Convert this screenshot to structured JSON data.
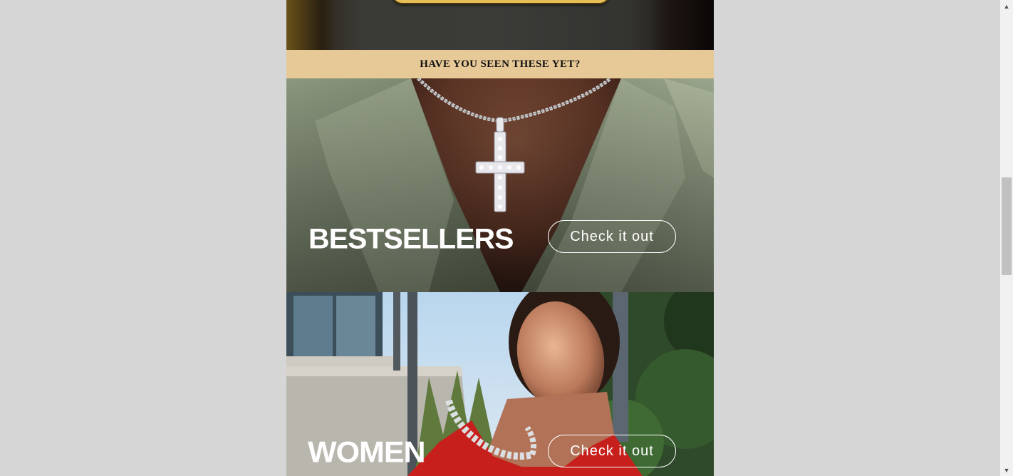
{
  "banner": {
    "heading": "HAVE YOU SEEN THESE YET?"
  },
  "tiles": [
    {
      "title": "BESTSELLERS",
      "cta_label": "Check it out"
    },
    {
      "title": "WOMEN",
      "cta_label": "Check it out"
    }
  ],
  "scrollbar": {
    "up_arrow": "▲",
    "down_arrow": "▼"
  },
  "colors": {
    "page_background": "#d6d6d6",
    "banner_background": "#e6c996",
    "accent_gold": "#e6bd57",
    "text_white": "#ffffff"
  }
}
